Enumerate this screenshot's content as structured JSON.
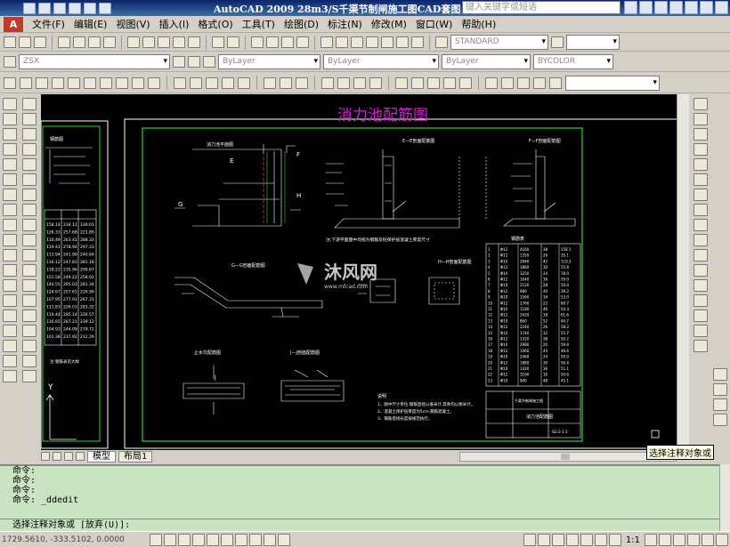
{
  "app": {
    "title": "AutoCAD 2009  28m3/S千渠节制闸施工图CAD套图",
    "search_placeholder": "键入关键字或短语"
  },
  "menu": [
    "文件(F)",
    "编辑(E)",
    "视图(V)",
    "插入(I)",
    "格式(O)",
    "工具(T)",
    "绘图(D)",
    "标注(N)",
    "修改(M)",
    "窗口(W)",
    "帮助(H)"
  ],
  "toolbars": {
    "text_style": "STANDARD",
    "layer": "ZSX",
    "color": "ByLayer",
    "linetype": "ByLayer",
    "lineweight": "ByLayer",
    "plot_style": "BYCOLOR"
  },
  "drawing": {
    "main_title": "消力池配筋图",
    "plan_title": "消力池平面图",
    "section_e": "E—E剖面配筋图",
    "section_f": "F—F剖面配筋图",
    "section_g": "G—G剖面配筋图",
    "section_h": "H—H剖面配筋图",
    "section_j": "J—J剖面配筋图",
    "detail_title": "止水坎配筋图",
    "plan_note": "注:下游平面图中均指为钢筋及砼保护层混凝土厚度尺寸",
    "notes_title": "说明",
    "notes": [
      "1、图中尺寸单位:钢筋直径以毫米计,其余均以厘米计。",
      "2、混凝土保护层厚度为5cm,钢筋混凝土。",
      "3、钢筋搭接长度按规范执行。"
    ],
    "title_block_name": "消力池配筋图",
    "title_block_org": "千渠节制闸施工图",
    "title_block_num": "SG-2-1-3",
    "rebar_table_title": "钢筋表",
    "rebar_rows": [
      [
        "1",
        "Φ12",
        "4160",
        "38",
        "158.1"
      ],
      [
        "2",
        "Φ12",
        "1350",
        "26",
        "35.1"
      ],
      [
        "3",
        "Φ10",
        "2840",
        "42",
        "119.3"
      ],
      [
        "4",
        "Φ12",
        "1860",
        "30",
        "55.8"
      ],
      [
        "5",
        "Φ10",
        "3250",
        "24",
        "78.0"
      ],
      [
        "6",
        "Φ12",
        "1640",
        "36",
        "59.0"
      ],
      [
        "7",
        "Φ10",
        "2120",
        "28",
        "59.4"
      ],
      [
        "8",
        "Φ12",
        "980",
        "40",
        "39.2"
      ],
      [
        "9",
        "Φ10",
        "1560",
        "34",
        "53.0"
      ],
      [
        "10",
        "Φ12",
        "2760",
        "22",
        "60.7"
      ],
      [
        "11",
        "Φ10",
        "1180",
        "46",
        "54.3"
      ],
      [
        "12",
        "Φ12",
        "3420",
        "18",
        "61.6"
      ],
      [
        "13",
        "Φ10",
        "860",
        "52",
        "44.7"
      ],
      [
        "14",
        "Φ12",
        "2240",
        "26",
        "58.2"
      ],
      [
        "15",
        "Φ10",
        "1740",
        "32",
        "55.7"
      ],
      [
        "16",
        "Φ12",
        "1320",
        "38",
        "50.2"
      ],
      [
        "17",
        "Φ10",
        "2980",
        "20",
        "59.6"
      ],
      [
        "18",
        "Φ12",
        "1060",
        "44",
        "46.6"
      ],
      [
        "19",
        "Φ10",
        "2460",
        "24",
        "59.0"
      ],
      [
        "20",
        "Φ12",
        "1880",
        "30",
        "56.4"
      ],
      [
        "21",
        "Φ10",
        "1420",
        "36",
        "51.1"
      ],
      [
        "22",
        "Φ12",
        "3160",
        "16",
        "50.6"
      ],
      [
        "23",
        "Φ10",
        "940",
        "48",
        "45.1"
      ]
    ],
    "left_table": [
      [
        "158.14",
        "234.11",
        "130.01"
      ],
      [
        "126.33",
        "257.68",
        "221.89"
      ],
      [
        "110.49",
        "263.41",
        "288.32"
      ],
      [
        "119.41",
        "278.94",
        "297.33"
      ],
      [
        "113.94",
        "241.90",
        "240.64"
      ],
      [
        "116.12",
        "247.83",
        "281.18"
      ],
      [
        "118.22",
        "235.96",
        "299.87"
      ],
      [
        "151.58",
        "249.22",
        "258.02"
      ],
      [
        "140.55",
        "265.03",
        "281.34"
      ],
      [
        "124.67",
        "257.61",
        "226.99"
      ],
      [
        "107.95",
        "277.91",
        "267.31"
      ],
      [
        "111.83",
        "226.03",
        "283.32"
      ],
      [
        "119.44",
        "285.14",
        "226.57"
      ],
      [
        "116.65",
        "287.21",
        "239.12"
      ],
      [
        "104.93",
        "244.09",
        "279.72"
      ],
      [
        "101.38",
        "237.92",
        "212.29"
      ]
    ],
    "left_note": "注:钢筋表见大样",
    "watermark_name": "沐风网",
    "watermark_url": "www.mfcad.com",
    "section_mark_e": "E",
    "section_mark_f": "F",
    "section_mark_g": "G",
    "section_mark_h": "H",
    "section_mark_j": "J"
  },
  "tabs": {
    "model": "模型",
    "layout1": "布局1"
  },
  "tooltip": "选择注释对象或",
  "command": {
    "history": [
      "命令:",
      "命令:",
      "命令:",
      "命令: _ddedit"
    ],
    "prompt": "选择注释对象或 [放弃(U)]:"
  },
  "status": {
    "coords": "1729.5610, -333.5102, 0.0000",
    "scale": "1:1"
  }
}
